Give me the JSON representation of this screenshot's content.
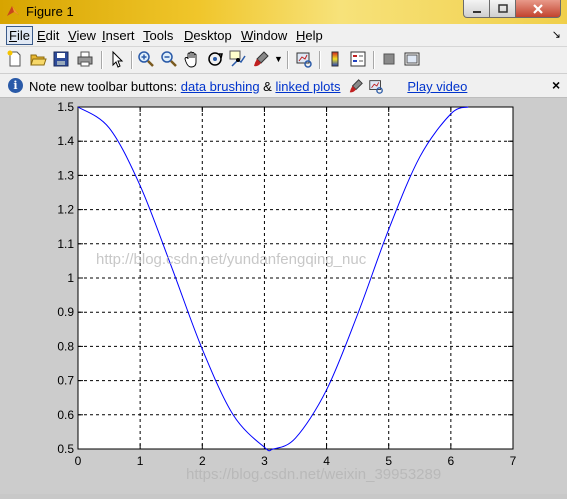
{
  "window": {
    "title": "Figure 1"
  },
  "menus": [
    {
      "label": "File",
      "key": "F",
      "rest": "ile"
    },
    {
      "label": "Edit",
      "key": "E",
      "rest": "dit"
    },
    {
      "label": "View",
      "key": "V",
      "rest": "iew"
    },
    {
      "label": "Insert",
      "key": "I",
      "rest": "nsert"
    },
    {
      "label": "Tools",
      "key": "T",
      "rest": "ools"
    },
    {
      "label": "Desktop",
      "key": "D",
      "rest": "esktop"
    },
    {
      "label": "Window",
      "key": "W",
      "rest": "indow"
    },
    {
      "label": "Help",
      "key": "H",
      "rest": "elp"
    }
  ],
  "toolbar": {
    "icons": [
      "new-figure-icon",
      "open-file-icon",
      "save-icon",
      "print-icon",
      "edit-plot-icon",
      "zoom-in-icon",
      "zoom-out-icon",
      "pan-icon",
      "rotate-3d-icon",
      "data-cursor-icon",
      "brush-icon",
      "brush-dropdown-icon",
      "link-plot-icon",
      "colorbar-icon",
      "legend-icon",
      "hide-plot-tools-icon",
      "show-plot-tools-icon"
    ]
  },
  "infobar": {
    "prefix": "Note new toolbar buttons: ",
    "link1": "data brushing",
    "amp": " & ",
    "link2": "linked plots",
    "link3": "Play video",
    "close": "×"
  },
  "watermarks": {
    "center": "http://blog.csdn.net/yundanfengqing_nuc",
    "bottom": "https://blog.csdn.net/weixin_39953289"
  },
  "chart_data": {
    "type": "line",
    "title": "",
    "xlabel": "",
    "ylabel": "",
    "xlim": [
      0,
      7
    ],
    "ylim": [
      0.5,
      1.5
    ],
    "xticks": [
      "0",
      "1",
      "2",
      "3",
      "4",
      "5",
      "6",
      "7"
    ],
    "yticks": [
      "0.5",
      "0.6",
      "0.7",
      "0.8",
      "0.9",
      "1",
      "1.1",
      "1.2",
      "1.3",
      "1.4",
      "1.5"
    ],
    "grid": true,
    "grid_style": "dashed",
    "series": [
      {
        "color": "#0000ff",
        "x": [
          0,
          0.5,
          1,
          1.5,
          2,
          2.5,
          3,
          3.14,
          3.5,
          4,
          4.5,
          5,
          5.5,
          6,
          6.28
        ],
        "y": [
          1.5,
          1.439,
          1.27,
          1.035,
          0.792,
          0.599,
          0.505,
          0.5,
          0.532,
          0.673,
          0.894,
          1.142,
          1.354,
          1.48,
          1.5
        ]
      }
    ]
  }
}
